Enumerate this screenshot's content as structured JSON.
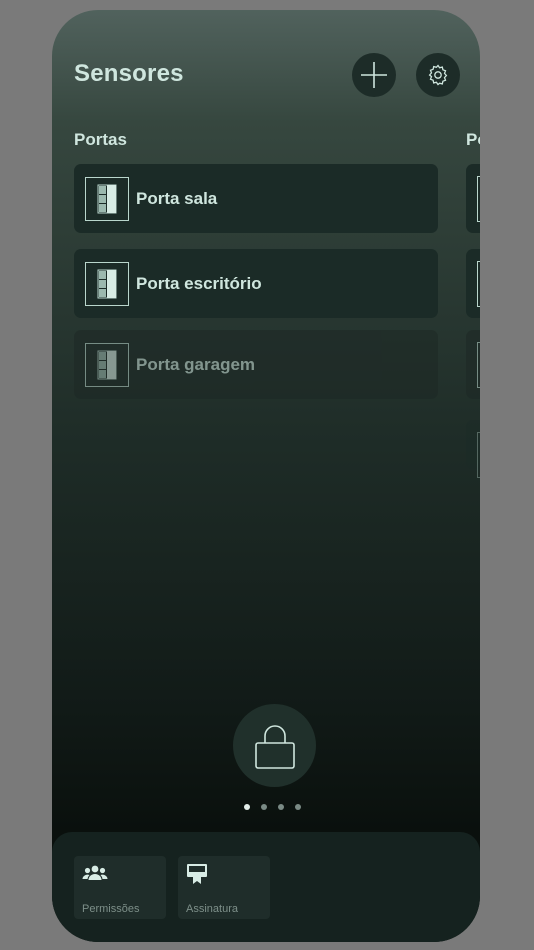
{
  "header": {
    "title": "Sensores"
  },
  "sections": {
    "current": "Portas",
    "next_peek": "Po"
  },
  "sensors": [
    {
      "label": "Porta sala",
      "enabled": true
    },
    {
      "label": "Porta escritório",
      "enabled": true
    },
    {
      "label": "Porta garagem",
      "enabled": false
    }
  ],
  "pager": {
    "pages": 4,
    "active": 1
  },
  "bottom_tabs": [
    {
      "label": "Permissões",
      "icon": "users-icon"
    },
    {
      "label": "Assinatura",
      "icon": "billboard-icon"
    }
  ],
  "colors": {
    "accent_text": "#cfe6de",
    "card_bg": "#1b2b27",
    "button_bg": "#1d2c28"
  }
}
